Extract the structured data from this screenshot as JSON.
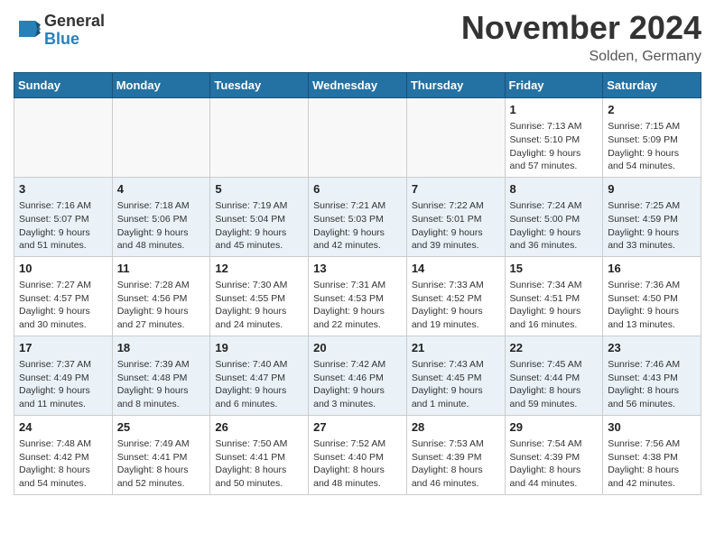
{
  "header": {
    "logo_line1": "General",
    "logo_line2": "Blue",
    "month_year": "November 2024",
    "location": "Solden, Germany"
  },
  "weekdays": [
    "Sunday",
    "Monday",
    "Tuesday",
    "Wednesday",
    "Thursday",
    "Friday",
    "Saturday"
  ],
  "weeks": [
    [
      {
        "day": "",
        "info": ""
      },
      {
        "day": "",
        "info": ""
      },
      {
        "day": "",
        "info": ""
      },
      {
        "day": "",
        "info": ""
      },
      {
        "day": "",
        "info": ""
      },
      {
        "day": "1",
        "info": "Sunrise: 7:13 AM\nSunset: 5:10 PM\nDaylight: 9 hours and 57 minutes."
      },
      {
        "day": "2",
        "info": "Sunrise: 7:15 AM\nSunset: 5:09 PM\nDaylight: 9 hours and 54 minutes."
      }
    ],
    [
      {
        "day": "3",
        "info": "Sunrise: 7:16 AM\nSunset: 5:07 PM\nDaylight: 9 hours and 51 minutes."
      },
      {
        "day": "4",
        "info": "Sunrise: 7:18 AM\nSunset: 5:06 PM\nDaylight: 9 hours and 48 minutes."
      },
      {
        "day": "5",
        "info": "Sunrise: 7:19 AM\nSunset: 5:04 PM\nDaylight: 9 hours and 45 minutes."
      },
      {
        "day": "6",
        "info": "Sunrise: 7:21 AM\nSunset: 5:03 PM\nDaylight: 9 hours and 42 minutes."
      },
      {
        "day": "7",
        "info": "Sunrise: 7:22 AM\nSunset: 5:01 PM\nDaylight: 9 hours and 39 minutes."
      },
      {
        "day": "8",
        "info": "Sunrise: 7:24 AM\nSunset: 5:00 PM\nDaylight: 9 hours and 36 minutes."
      },
      {
        "day": "9",
        "info": "Sunrise: 7:25 AM\nSunset: 4:59 PM\nDaylight: 9 hours and 33 minutes."
      }
    ],
    [
      {
        "day": "10",
        "info": "Sunrise: 7:27 AM\nSunset: 4:57 PM\nDaylight: 9 hours and 30 minutes."
      },
      {
        "day": "11",
        "info": "Sunrise: 7:28 AM\nSunset: 4:56 PM\nDaylight: 9 hours and 27 minutes."
      },
      {
        "day": "12",
        "info": "Sunrise: 7:30 AM\nSunset: 4:55 PM\nDaylight: 9 hours and 24 minutes."
      },
      {
        "day": "13",
        "info": "Sunrise: 7:31 AM\nSunset: 4:53 PM\nDaylight: 9 hours and 22 minutes."
      },
      {
        "day": "14",
        "info": "Sunrise: 7:33 AM\nSunset: 4:52 PM\nDaylight: 9 hours and 19 minutes."
      },
      {
        "day": "15",
        "info": "Sunrise: 7:34 AM\nSunset: 4:51 PM\nDaylight: 9 hours and 16 minutes."
      },
      {
        "day": "16",
        "info": "Sunrise: 7:36 AM\nSunset: 4:50 PM\nDaylight: 9 hours and 13 minutes."
      }
    ],
    [
      {
        "day": "17",
        "info": "Sunrise: 7:37 AM\nSunset: 4:49 PM\nDaylight: 9 hours and 11 minutes."
      },
      {
        "day": "18",
        "info": "Sunrise: 7:39 AM\nSunset: 4:48 PM\nDaylight: 9 hours and 8 minutes."
      },
      {
        "day": "19",
        "info": "Sunrise: 7:40 AM\nSunset: 4:47 PM\nDaylight: 9 hours and 6 minutes."
      },
      {
        "day": "20",
        "info": "Sunrise: 7:42 AM\nSunset: 4:46 PM\nDaylight: 9 hours and 3 minutes."
      },
      {
        "day": "21",
        "info": "Sunrise: 7:43 AM\nSunset: 4:45 PM\nDaylight: 9 hours and 1 minute."
      },
      {
        "day": "22",
        "info": "Sunrise: 7:45 AM\nSunset: 4:44 PM\nDaylight: 8 hours and 59 minutes."
      },
      {
        "day": "23",
        "info": "Sunrise: 7:46 AM\nSunset: 4:43 PM\nDaylight: 8 hours and 56 minutes."
      }
    ],
    [
      {
        "day": "24",
        "info": "Sunrise: 7:48 AM\nSunset: 4:42 PM\nDaylight: 8 hours and 54 minutes."
      },
      {
        "day": "25",
        "info": "Sunrise: 7:49 AM\nSunset: 4:41 PM\nDaylight: 8 hours and 52 minutes."
      },
      {
        "day": "26",
        "info": "Sunrise: 7:50 AM\nSunset: 4:41 PM\nDaylight: 8 hours and 50 minutes."
      },
      {
        "day": "27",
        "info": "Sunrise: 7:52 AM\nSunset: 4:40 PM\nDaylight: 8 hours and 48 minutes."
      },
      {
        "day": "28",
        "info": "Sunrise: 7:53 AM\nSunset: 4:39 PM\nDaylight: 8 hours and 46 minutes."
      },
      {
        "day": "29",
        "info": "Sunrise: 7:54 AM\nSunset: 4:39 PM\nDaylight: 8 hours and 44 minutes."
      },
      {
        "day": "30",
        "info": "Sunrise: 7:56 AM\nSunset: 4:38 PM\nDaylight: 8 hours and 42 minutes."
      }
    ]
  ]
}
